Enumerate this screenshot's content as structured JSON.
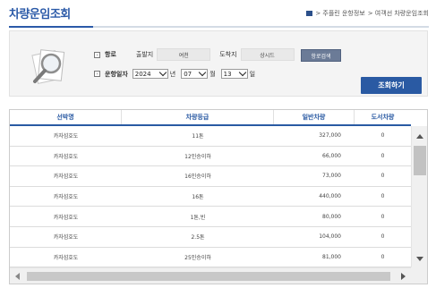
{
  "page": {
    "title": "차량운임조회",
    "breadcrumb": [
      "> 주플린 운항정보",
      "> 여객선 차량운임조회"
    ]
  },
  "search": {
    "route_label": "항로",
    "departure_label": "출발지",
    "departure_value": "여천",
    "arrival_label": "도착지",
    "arrival_value": "상시드",
    "route_button": "항로검색",
    "date_label": "운항일자",
    "year_value": "2024",
    "year_suffix": "년",
    "month_value": "07",
    "month_suffix": "월",
    "day_value": "13",
    "day_suffix": "일",
    "search_button": "조회하기"
  },
  "table": {
    "columns": [
      "선박명",
      "차량등급",
      "일반차량",
      "도서차량"
    ],
    "rows": [
      [
        "카자섬호도",
        "11톤",
        "327,000",
        "0"
      ],
      [
        "카자섬호도",
        "12인승이하",
        "66,000",
        "0"
      ],
      [
        "카자섬호도",
        "16인승이하",
        "73,000",
        "0"
      ],
      [
        "카자섬호도",
        "16톤",
        "440,000",
        "0"
      ],
      [
        "카자섬호도",
        "1톤,빈",
        "80,000",
        "0"
      ],
      [
        "카자섬호도",
        "2.5톤",
        "104,000",
        "0"
      ],
      [
        "카자섬호도",
        "25인승이하",
        "81,000",
        "0"
      ]
    ]
  },
  "colors": {
    "accent": "#2a5aa3",
    "title": "#2b5aa8",
    "route_button": "#6b7b97"
  },
  "icons": [
    "home-icon",
    "magnifier-icon",
    "chevron-down-icon",
    "arrow-up-icon",
    "arrow-down-icon",
    "arrow-left-icon",
    "arrow-right-icon"
  ]
}
